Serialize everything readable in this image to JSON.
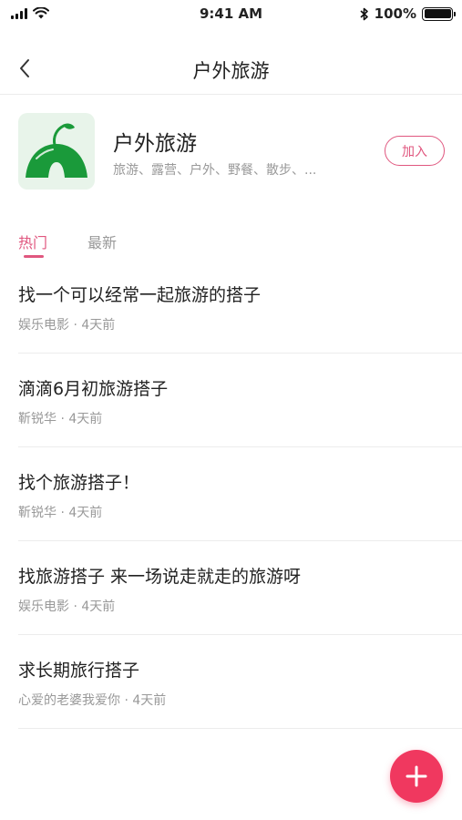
{
  "status_bar": {
    "time": "9:41 AM",
    "battery_percent": "100%",
    "icons": [
      "signal-icon",
      "wifi-icon",
      "bluetooth-icon",
      "battery-icon"
    ]
  },
  "nav": {
    "title": "户外旅游",
    "back_icon": "chevron-left-icon"
  },
  "group": {
    "name": "户外旅游",
    "tags": "旅游、露营、户外、野餐、散步、...",
    "join_label": "加入",
    "logo_icon": "tent-icon"
  },
  "tabs": [
    {
      "label": "热门",
      "active": true
    },
    {
      "label": "最新",
      "active": false
    }
  ],
  "posts": [
    {
      "title": "找一个可以经常一起旅游的搭子",
      "author": "娱乐电影",
      "time": "4天前"
    },
    {
      "title": "滴滴6月初旅游搭子",
      "author": "靳锐华",
      "time": "4天前"
    },
    {
      "title": "找个旅游搭子！",
      "author": "靳锐华",
      "time": "4天前"
    },
    {
      "title": "找旅游搭子 来一场说走就走的旅游呀",
      "author": "娱乐电影",
      "time": "4天前"
    },
    {
      "title": "求长期旅行搭子",
      "author": "心爱的老婆我爱你",
      "time": "4天前"
    }
  ],
  "meta_separator": "·",
  "fab_icon": "plus-icon",
  "colors": {
    "accent": "#e0577f",
    "fab": "#f0385f",
    "logo_green": "#1a9a3a",
    "logo_bg": "#e8f4ea"
  }
}
